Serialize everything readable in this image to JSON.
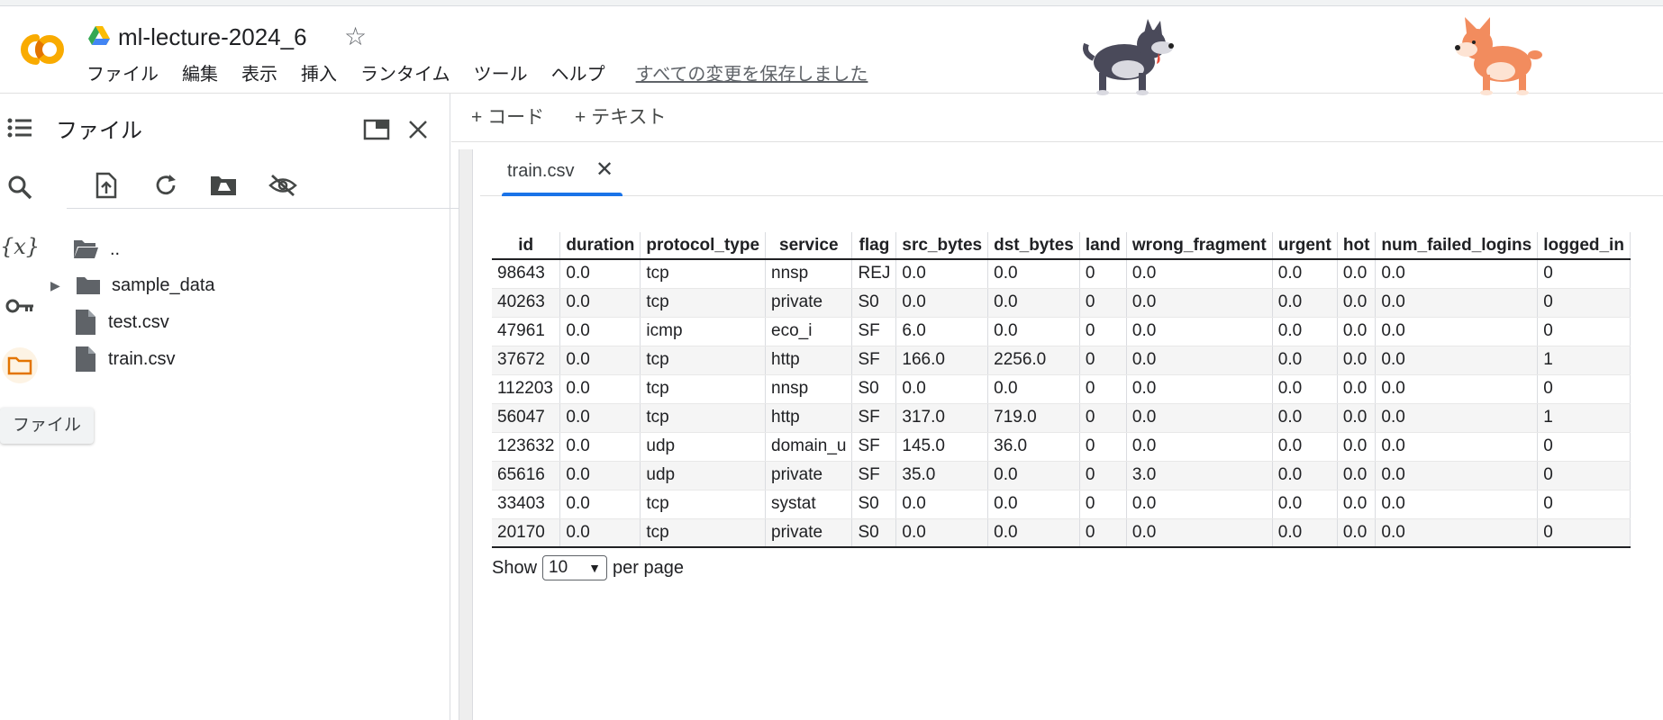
{
  "header": {
    "title": "ml-lecture-2024_6",
    "menu": [
      "ファイル",
      "編集",
      "表示",
      "挿入",
      "ランタイム",
      "ツール",
      "ヘルプ"
    ],
    "save_status": "すべての変更を保存しました",
    "logo_icon": "colab-logo",
    "drive_icon": "google-drive-icon",
    "star_icon": "star-outline-icon"
  },
  "rail": {
    "items": [
      "table-of-contents-icon",
      "search-icon",
      "variables-icon",
      "key-icon",
      "folder-icon"
    ],
    "variables_glyph": "{x}",
    "tooltip": "ファイル"
  },
  "files": {
    "title": "ファイル",
    "tree": [
      {
        "label": "..",
        "type": "folder-open"
      },
      {
        "label": "sample_data",
        "type": "folder"
      },
      {
        "label": "test.csv",
        "type": "file"
      },
      {
        "label": "train.csv",
        "type": "file"
      }
    ]
  },
  "main": {
    "add_code": "+ コード",
    "add_text": "+ テキスト",
    "tab_label": "train.csv",
    "tab_close": "✕",
    "columns": [
      "id",
      "duration",
      "protocol_type",
      "service",
      "flag",
      "src_bytes",
      "dst_bytes",
      "land",
      "wrong_fragment",
      "urgent",
      "hot",
      "num_failed_logins",
      "logged_in"
    ],
    "rows": [
      [
        "98643",
        "0.0",
        "tcp",
        "nnsp",
        "REJ",
        "0.0",
        "0.0",
        "0",
        "0.0",
        "0.0",
        "0.0",
        "0.0",
        "0"
      ],
      [
        "40263",
        "0.0",
        "tcp",
        "private",
        "S0",
        "0.0",
        "0.0",
        "0",
        "0.0",
        "0.0",
        "0.0",
        "0.0",
        "0"
      ],
      [
        "47961",
        "0.0",
        "icmp",
        "eco_i",
        "SF",
        "6.0",
        "0.0",
        "0",
        "0.0",
        "0.0",
        "0.0",
        "0.0",
        "0"
      ],
      [
        "37672",
        "0.0",
        "tcp",
        "http",
        "SF",
        "166.0",
        "2256.0",
        "0",
        "0.0",
        "0.0",
        "0.0",
        "0.0",
        "1"
      ],
      [
        "112203",
        "0.0",
        "tcp",
        "nnsp",
        "S0",
        "0.0",
        "0.0",
        "0",
        "0.0",
        "0.0",
        "0.0",
        "0.0",
        "0"
      ],
      [
        "56047",
        "0.0",
        "tcp",
        "http",
        "SF",
        "317.0",
        "719.0",
        "0",
        "0.0",
        "0.0",
        "0.0",
        "0.0",
        "1"
      ],
      [
        "123632",
        "0.0",
        "udp",
        "domain_u",
        "SF",
        "145.0",
        "36.0",
        "0",
        "0.0",
        "0.0",
        "0.0",
        "0.0",
        "0"
      ],
      [
        "65616",
        "0.0",
        "udp",
        "private",
        "SF",
        "35.0",
        "0.0",
        "0",
        "3.0",
        "0.0",
        "0.0",
        "0.0",
        "0"
      ],
      [
        "33403",
        "0.0",
        "tcp",
        "systat",
        "S0",
        "0.0",
        "0.0",
        "0",
        "0.0",
        "0.0",
        "0.0",
        "0.0",
        "0"
      ],
      [
        "20170",
        "0.0",
        "tcp",
        "private",
        "S0",
        "0.0",
        "0.0",
        "0",
        "0.0",
        "0.0",
        "0.0",
        "0.0",
        "0"
      ]
    ],
    "pager_show": "Show",
    "pager_value": "10",
    "pager_suffix": "per page"
  },
  "colors": {
    "logo_orange": "#f9ab00",
    "logo_dark_orange": "#e37400",
    "tab_underline": "#1a73e8",
    "dog_left": "#4a4a5a",
    "dog_right": "#f28c5e"
  }
}
